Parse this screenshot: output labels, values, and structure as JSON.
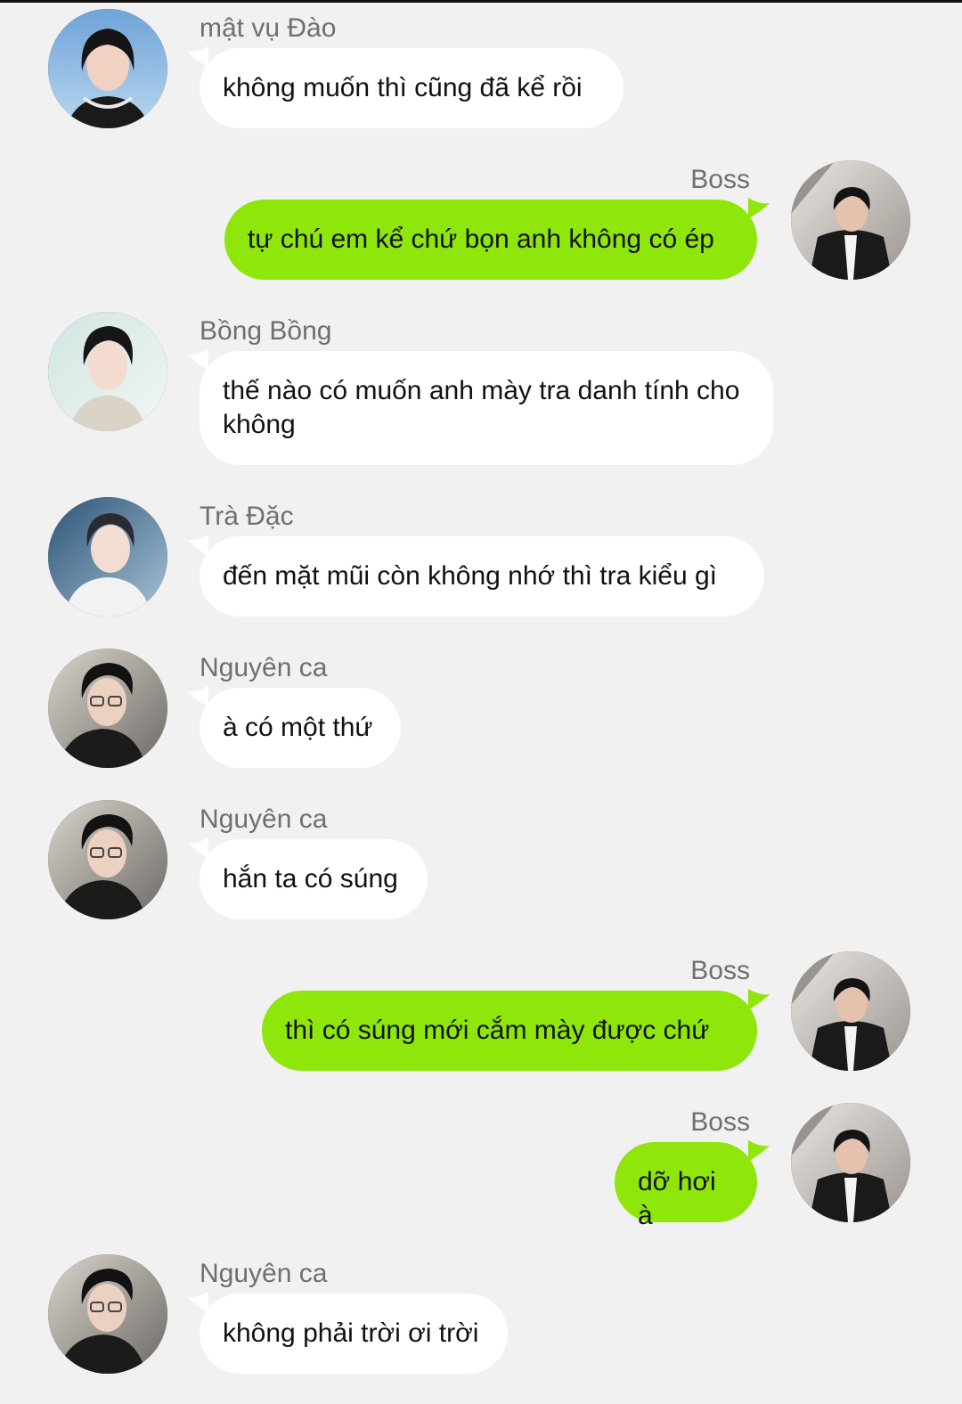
{
  "chat": {
    "messages": [
      {
        "sender": "mật vụ Đào",
        "text": "không muốn thì cũng đã kể rồi",
        "side": "left",
        "avatar": "woman-short-hair-avatar"
      },
      {
        "sender": "Boss",
        "text": "tự chú em kể chứ bọn anh không có ép",
        "side": "right",
        "avatar": "man-black-suit-avatar"
      },
      {
        "sender": "Bồng Bồng",
        "text": "thế nào có muốn anh mày tra danh tính cho không",
        "side": "left",
        "avatar": "young-man-light-shirt-avatar"
      },
      {
        "sender": "Trà Đặc",
        "text": "đến mặt mũi còn không nhớ thì tra kiểu gì",
        "side": "left",
        "avatar": "young-man-white-outfit-avatar"
      },
      {
        "sender": "Nguyên ca",
        "text": "à có một thứ",
        "side": "left",
        "avatar": "man-glasses-avatar"
      },
      {
        "sender": "Nguyên ca",
        "text": "hắn ta có súng",
        "side": "left",
        "avatar": "man-glasses-avatar"
      },
      {
        "sender": "Boss",
        "text": "thì có súng mới cắm mày được chứ",
        "side": "right",
        "avatar": "man-black-suit-avatar"
      },
      {
        "sender": "Boss",
        "text": "dỡ hơi à",
        "side": "right",
        "avatar": "man-black-suit-avatar"
      },
      {
        "sender": "Nguyên ca",
        "text": "không phải trời ơi trời",
        "side": "left",
        "avatar": "man-glasses-avatar"
      }
    ]
  },
  "colors": {
    "background": "#f1f1f1",
    "incoming_bubble": "#ffffff",
    "outgoing_bubble": "#8ee60a",
    "sender_name": "#6f6f6f"
  }
}
